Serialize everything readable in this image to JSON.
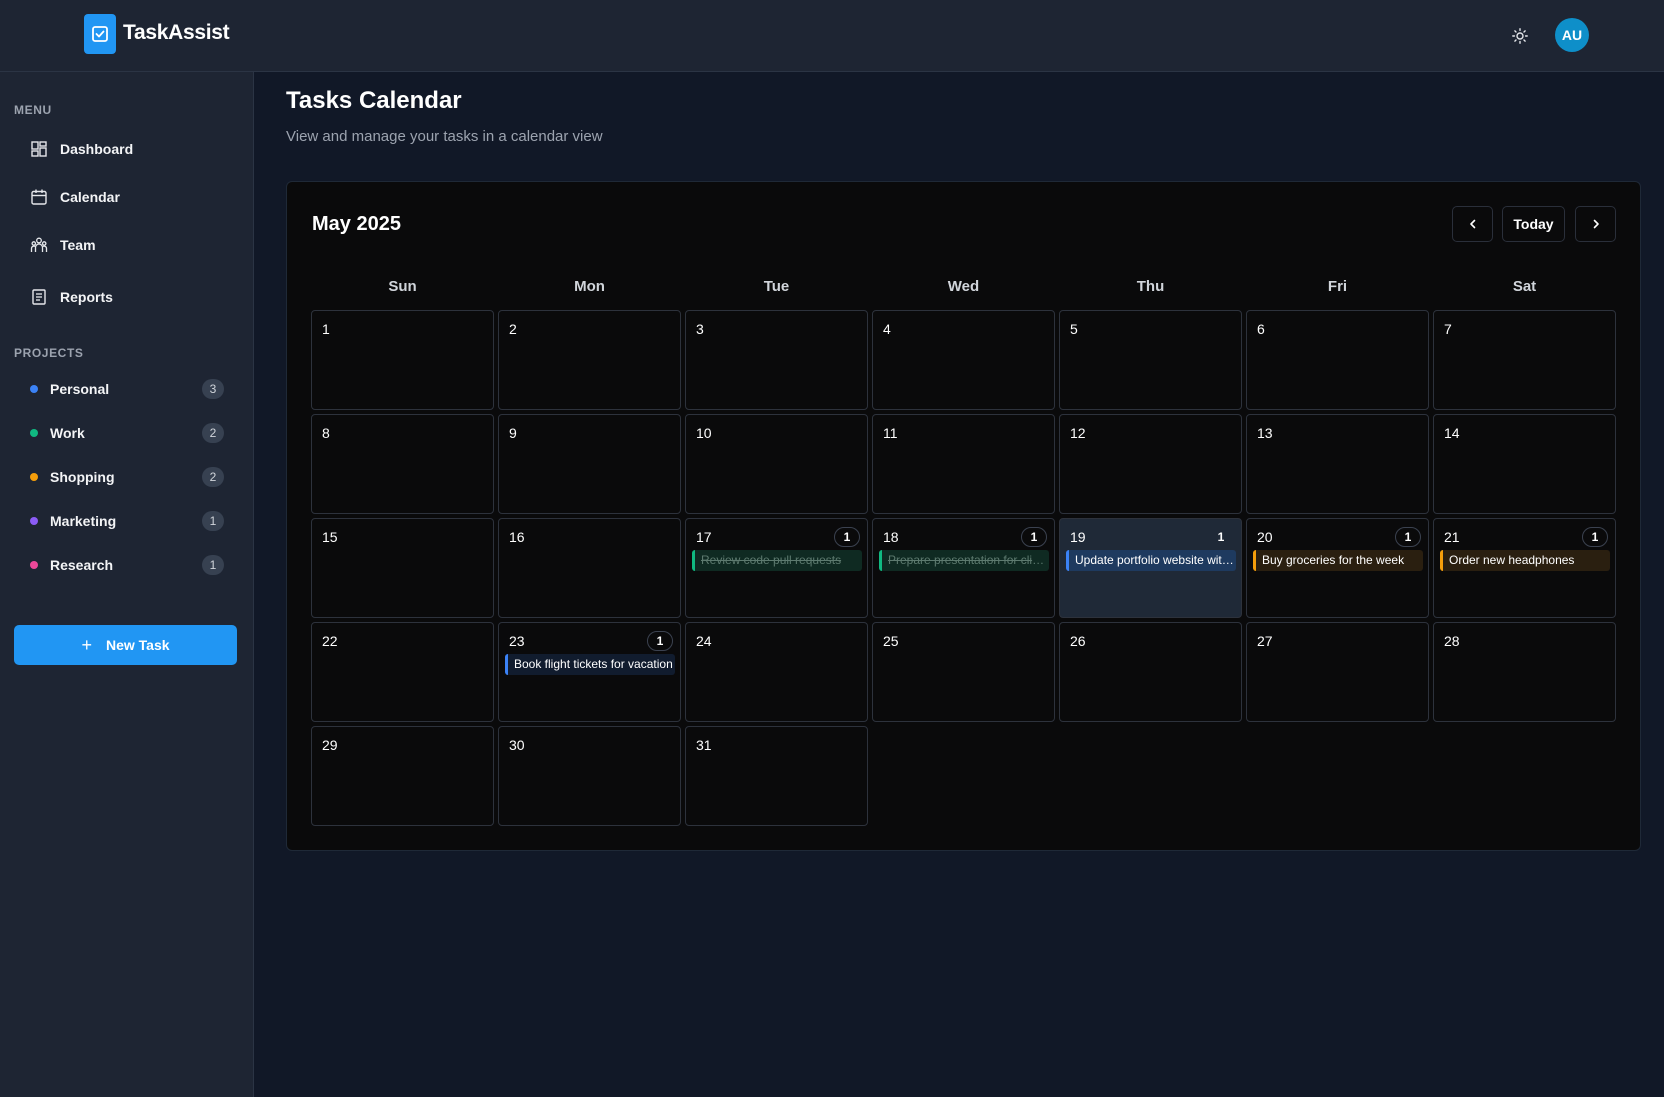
{
  "app": {
    "name": "TaskAssist",
    "avatar_initials": "AU"
  },
  "sidebar": {
    "menu_label": "MENU",
    "menu": [
      {
        "label": "Dashboard",
        "icon": "dashboard-icon"
      },
      {
        "label": "Calendar",
        "icon": "calendar-icon"
      },
      {
        "label": "Team",
        "icon": "team-icon"
      },
      {
        "label": "Reports",
        "icon": "reports-icon"
      }
    ],
    "projects_label": "PROJECTS",
    "projects": [
      {
        "label": "Personal",
        "count": "3",
        "color": "#3b82f6"
      },
      {
        "label": "Work",
        "count": "2",
        "color": "#10b981"
      },
      {
        "label": "Shopping",
        "count": "2",
        "color": "#f59e0b"
      },
      {
        "label": "Marketing",
        "count": "1",
        "color": "#8b5cf6"
      },
      {
        "label": "Research",
        "count": "1",
        "color": "#ec4899"
      }
    ],
    "new_task_label": "New Task"
  },
  "page": {
    "title": "Tasks Calendar",
    "subtitle": "View and manage your tasks in a calendar view"
  },
  "calendar": {
    "month_label": "May 2025",
    "today_label": "Today",
    "weekdays": [
      "Sun",
      "Mon",
      "Tue",
      "Wed",
      "Thu",
      "Fri",
      "Sat"
    ],
    "first_weekday_index": 4,
    "days_in_month": 31,
    "today": 19,
    "tasks": {
      "17": {
        "count": "1",
        "title": "Review code pull requests",
        "color": "#10b981",
        "bg": "#0f2a22",
        "completed": true
      },
      "18": {
        "count": "1",
        "title": "Prepare presentation for client meeting",
        "color": "#10b981",
        "bg": "#0f2a22",
        "completed": true
      },
      "19": {
        "count": "1",
        "title": "Update portfolio website with new projects",
        "color": "#3b82f6",
        "bg": "#1e3a5f",
        "completed": false
      },
      "20": {
        "count": "1",
        "title": "Buy groceries for the week",
        "color": "#f59e0b",
        "bg": "#2a1f10",
        "completed": false
      },
      "21": {
        "count": "1",
        "title": "Order new headphones",
        "color": "#f59e0b",
        "bg": "#2a1f10",
        "completed": false
      },
      "23": {
        "count": "1",
        "title": "Book flight tickets for vacation",
        "color": "#3b82f6",
        "bg": "#111c2e",
        "completed": false
      }
    }
  }
}
